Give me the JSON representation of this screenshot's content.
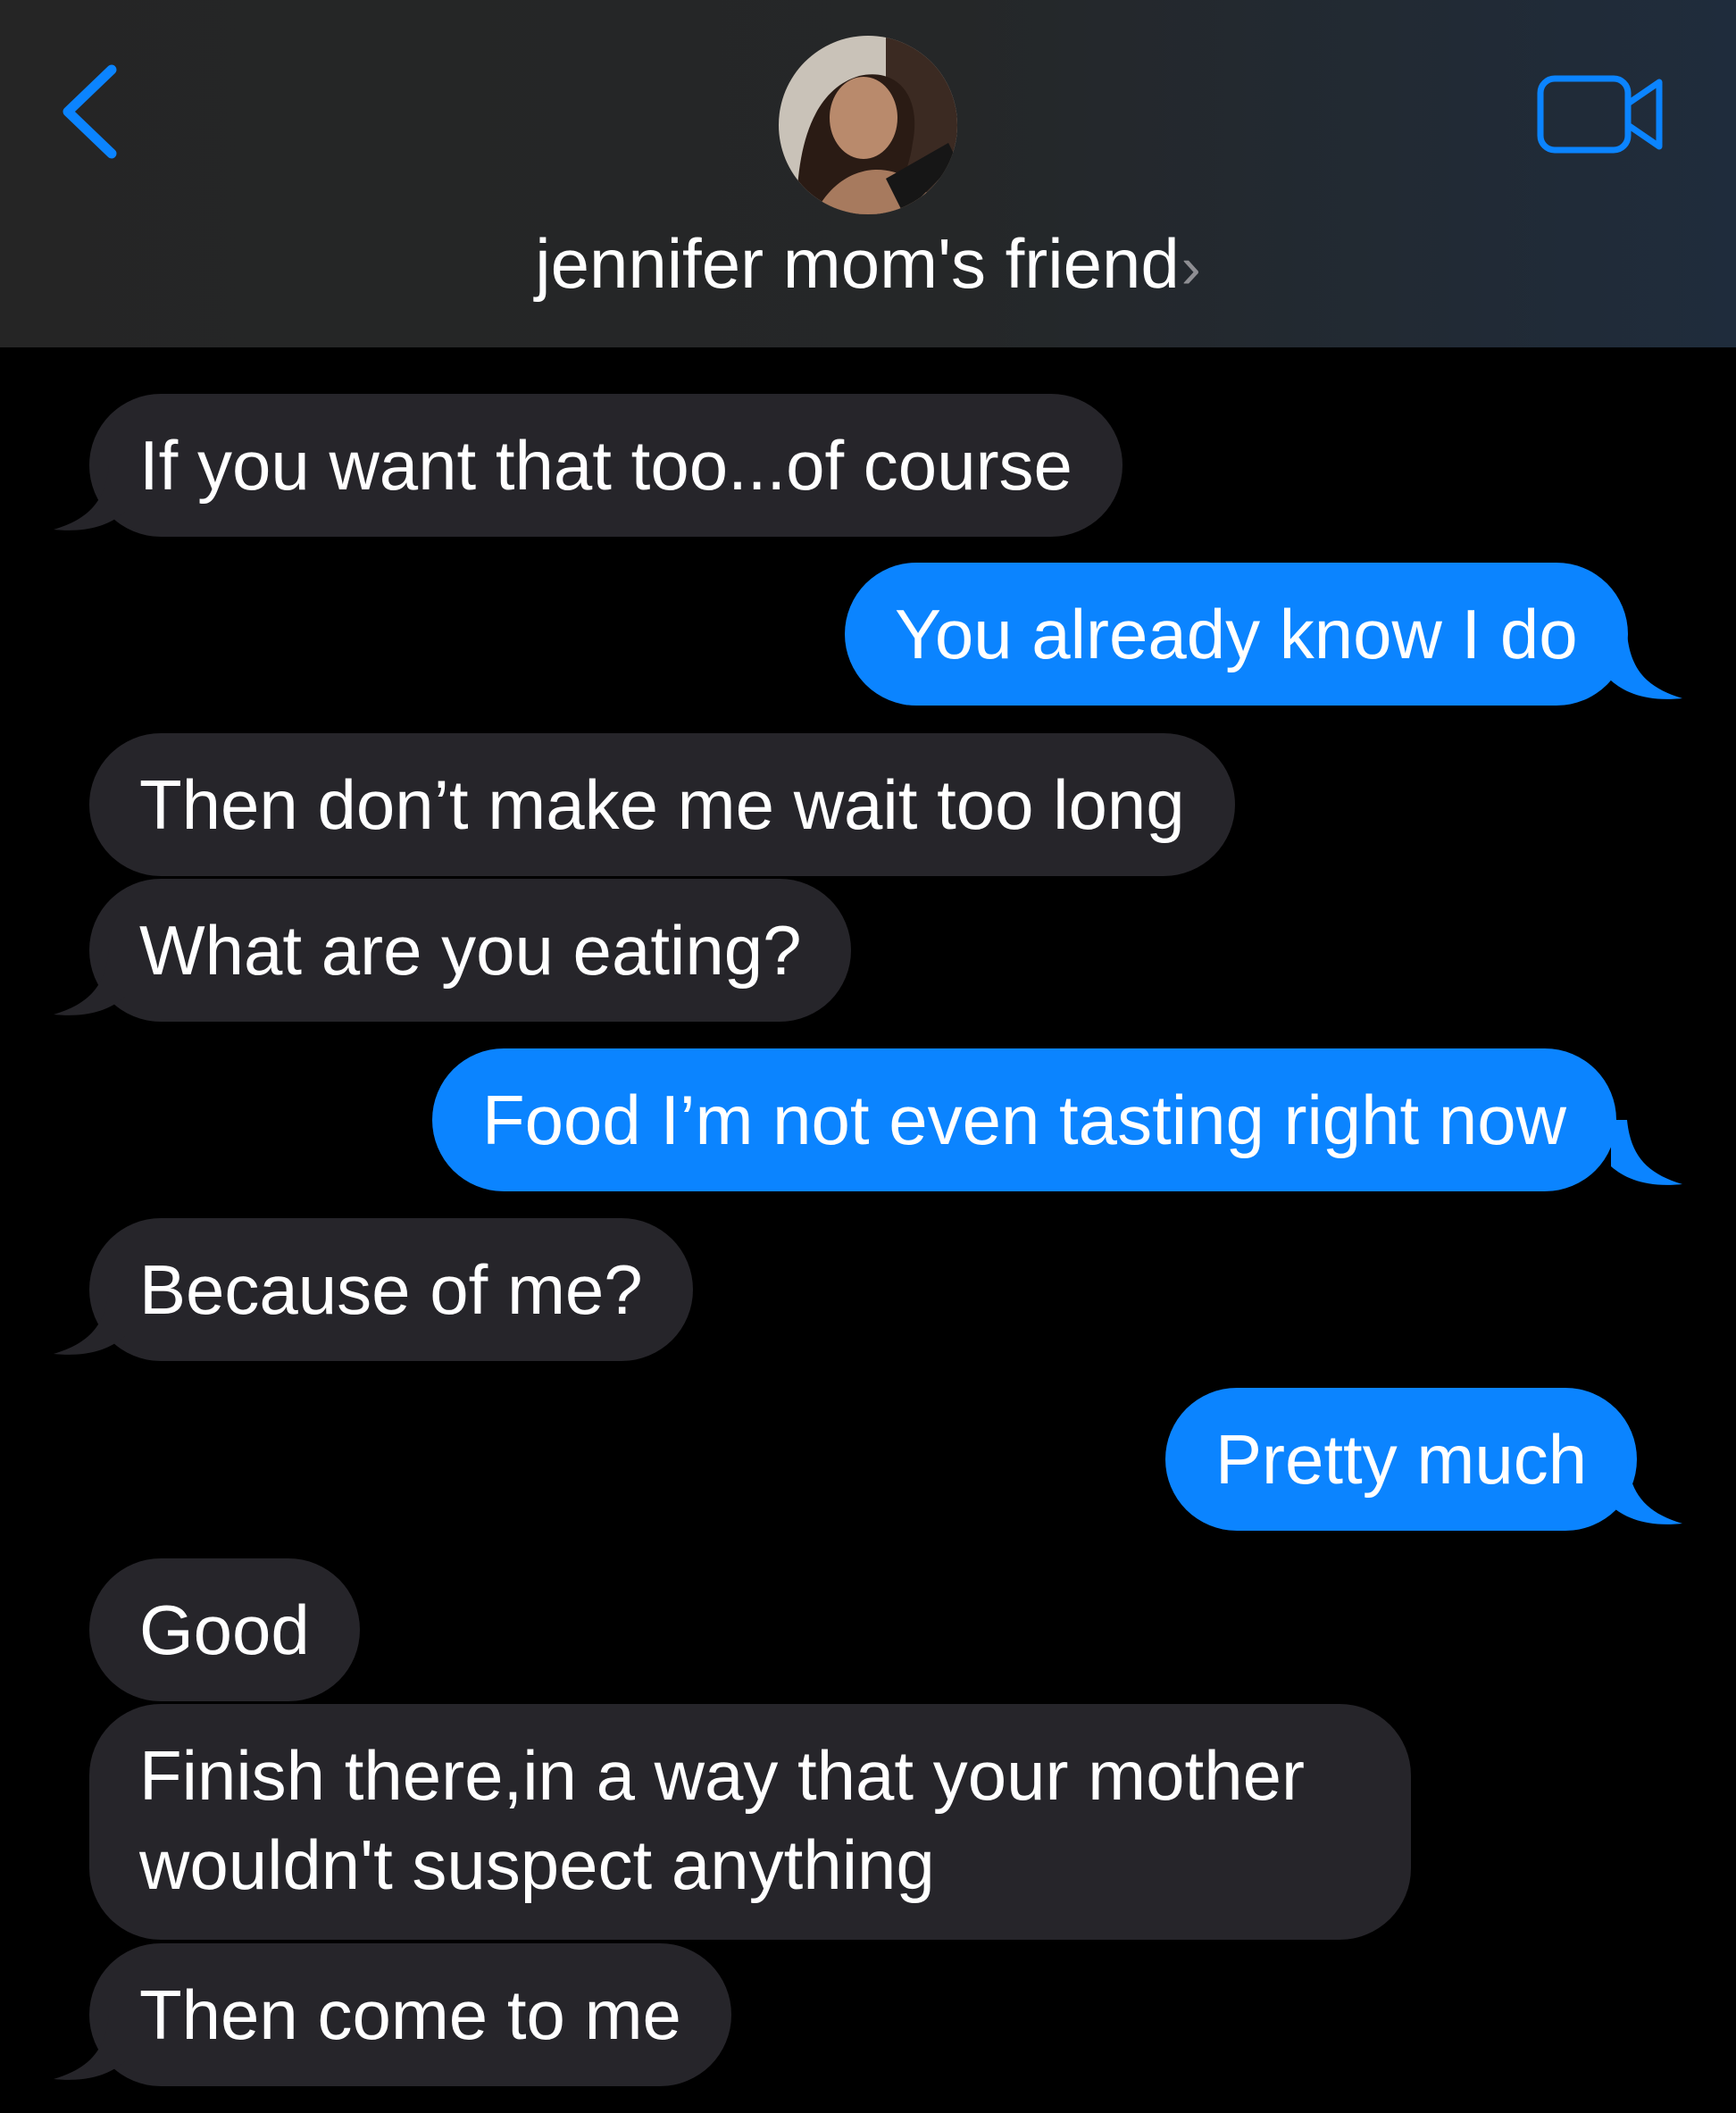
{
  "header": {
    "contact_name": "jennifer mom's friend",
    "chevron": "›",
    "back_icon": "chevron-left-icon",
    "video_icon": "video-camera-icon",
    "accent_color": "#0b84ff"
  },
  "colors": {
    "incoming_bubble": "#26252a",
    "outgoing_bubble": "#0b84ff",
    "background": "#000000"
  },
  "messages": [
    {
      "direction": "incoming",
      "text": "If you want that too...of course"
    },
    {
      "direction": "outgoing",
      "text": "You already know I do"
    },
    {
      "direction": "incoming",
      "text": "Then don’t make me wait too long"
    },
    {
      "direction": "incoming",
      "text": "What are you eating?"
    },
    {
      "direction": "outgoing",
      "text": "Food I’m not even tasting right now"
    },
    {
      "direction": "incoming",
      "text": "Because of me?"
    },
    {
      "direction": "outgoing",
      "text": "Pretty much"
    },
    {
      "direction": "incoming",
      "text": "Good"
    },
    {
      "direction": "incoming",
      "text": "Finish there,in a way that your mother wouldn't suspect anything"
    },
    {
      "direction": "incoming",
      "text": "Then come to me"
    }
  ]
}
